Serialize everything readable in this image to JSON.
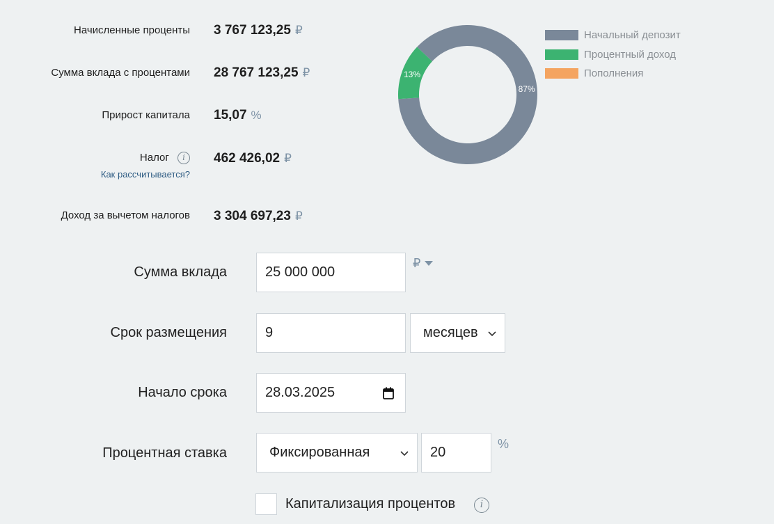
{
  "results": {
    "accrued_interest": {
      "label": "Начисленные проценты",
      "value": "3 767 123,25",
      "unit": "₽"
    },
    "total_with_interest": {
      "label": "Сумма вклада с процентами",
      "value": "28 767 123,25",
      "unit": "₽"
    },
    "capital_growth": {
      "label": "Прирост капитала",
      "value": "15,07",
      "unit": "%"
    },
    "tax": {
      "label": "Налог",
      "value": "462 426,02",
      "unit": "₽",
      "link": "Как рассчитывается?",
      "info": "i"
    },
    "net_income": {
      "label": "Доход за вычетом налогов",
      "value": "3 304 697,23",
      "unit": "₽"
    }
  },
  "chart_data": {
    "type": "pie",
    "donut": true,
    "slices": [
      {
        "name": "Начальный депозит",
        "value": 87,
        "label": "87%",
        "color": "#7a8899"
      },
      {
        "name": "Процентный доход",
        "value": 13,
        "label": "13%",
        "color": "#3cb371"
      },
      {
        "name": "Пополнения",
        "value": 0,
        "label": "",
        "color": "#f4a460"
      }
    ],
    "legend_position": "right"
  },
  "form": {
    "deposit_amount": {
      "label": "Сумма вклада",
      "value": "25 000 000",
      "currency": "₽"
    },
    "term": {
      "label": "Срок размещения",
      "value": "9",
      "unit_selected": "месяцев"
    },
    "start_date": {
      "label": "Начало срока",
      "value": "28.03.2025"
    },
    "interest_rate": {
      "label": "Процентная ставка",
      "type_selected": "Фиксированная",
      "value": "20",
      "unit": "%"
    },
    "capitalization": {
      "label": "Капитализация процентов",
      "checked": false,
      "info": "i"
    }
  }
}
